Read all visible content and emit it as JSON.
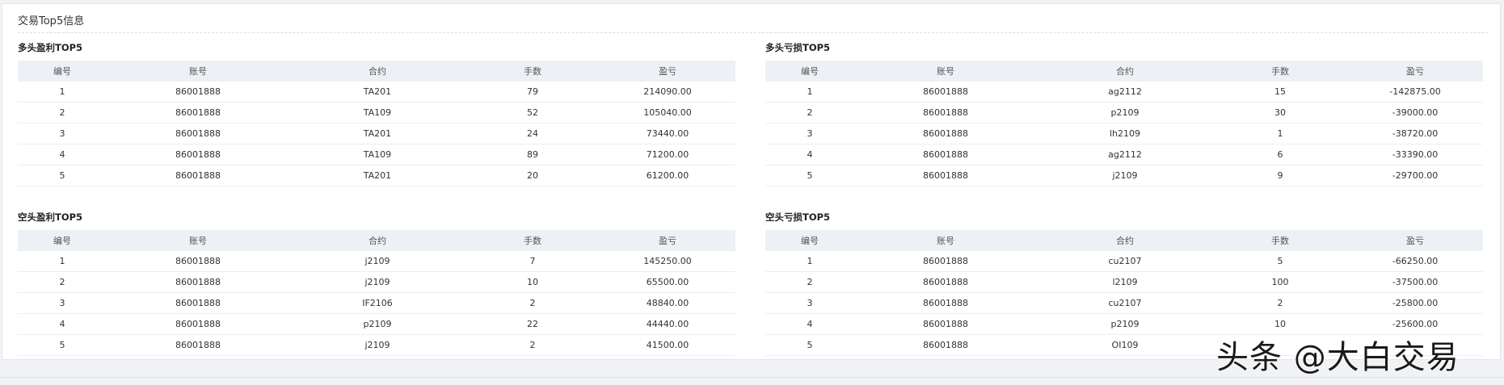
{
  "panel": {
    "title": "交易Top5信息"
  },
  "columns": [
    "编号",
    "账号",
    "合约",
    "手数",
    "盈亏"
  ],
  "sections": {
    "long_profit": {
      "title": "多头盈利TOP5",
      "rows": [
        [
          "1",
          "86001888",
          "TA201",
          "79",
          "214090.00"
        ],
        [
          "2",
          "86001888",
          "TA109",
          "52",
          "105040.00"
        ],
        [
          "3",
          "86001888",
          "TA201",
          "24",
          "73440.00"
        ],
        [
          "4",
          "86001888",
          "TA109",
          "89",
          "71200.00"
        ],
        [
          "5",
          "86001888",
          "TA201",
          "20",
          "61200.00"
        ]
      ]
    },
    "long_loss": {
      "title": "多头亏损TOP5",
      "rows": [
        [
          "1",
          "86001888",
          "ag2112",
          "15",
          "-142875.00"
        ],
        [
          "2",
          "86001888",
          "p2109",
          "30",
          "-39000.00"
        ],
        [
          "3",
          "86001888",
          "lh2109",
          "1",
          "-38720.00"
        ],
        [
          "4",
          "86001888",
          "ag2112",
          "6",
          "-33390.00"
        ],
        [
          "5",
          "86001888",
          "j2109",
          "9",
          "-29700.00"
        ]
      ]
    },
    "short_profit": {
      "title": "空头盈利TOP5",
      "rows": [
        [
          "1",
          "86001888",
          "j2109",
          "7",
          "145250.00"
        ],
        [
          "2",
          "86001888",
          "j2109",
          "10",
          "65500.00"
        ],
        [
          "3",
          "86001888",
          "IF2106",
          "2",
          "48840.00"
        ],
        [
          "4",
          "86001888",
          "p2109",
          "22",
          "44440.00"
        ],
        [
          "5",
          "86001888",
          "j2109",
          "2",
          "41500.00"
        ]
      ]
    },
    "short_loss": {
      "title": "空头亏损TOP5",
      "rows": [
        [
          "1",
          "86001888",
          "cu2107",
          "5",
          "-66250.00"
        ],
        [
          "2",
          "86001888",
          "l2109",
          "100",
          "-37500.00"
        ],
        [
          "3",
          "86001888",
          "cu2107",
          "2",
          "-25800.00"
        ],
        [
          "4",
          "86001888",
          "p2109",
          "10",
          "-25600.00"
        ],
        [
          "5",
          "86001888",
          "OI109",
          "",
          ""
        ]
      ]
    }
  },
  "watermark": "头条 @大白交易",
  "colors": {
    "profit": "#d9001b",
    "loss": "#1aa11a",
    "header_bg": "#edf0f5"
  }
}
